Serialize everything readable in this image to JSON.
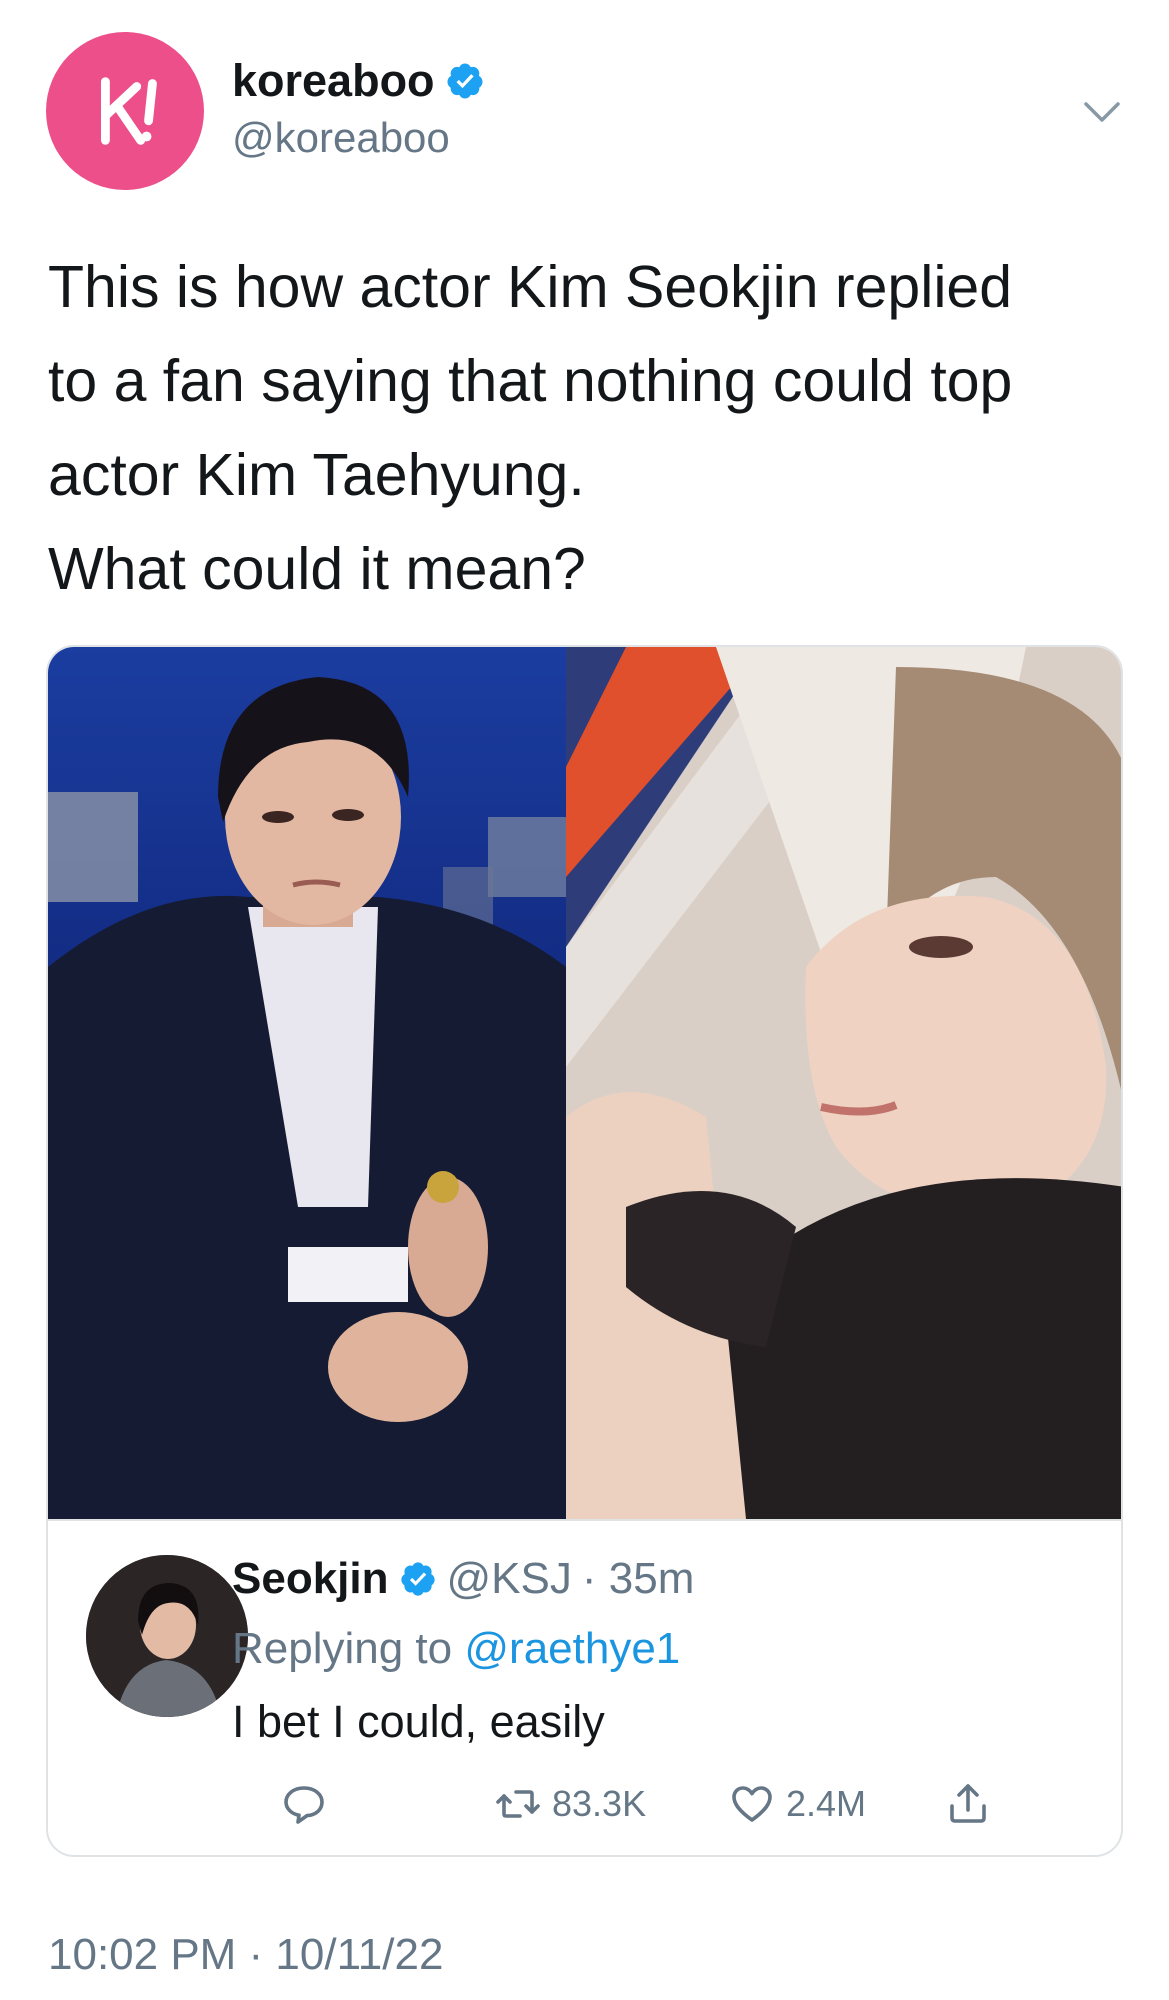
{
  "tweet": {
    "display_name": "koreaboo",
    "handle": "@koreaboo",
    "avatar_letter": "k!",
    "avatar_color": "#ec4f8a",
    "text_lines": [
      "This is how actor Kim Seokjin replied",
      "to a fan saying that nothing could top",
      "actor Kim Taehyung.",
      "What could it mean?"
    ],
    "timestamp": "10:02 PM · 10/11/22"
  },
  "quoted_reply": {
    "display_name": "Seokjin",
    "handle": "@KSJ",
    "time": "· 35m",
    "replying_label": "Replying to",
    "replying_to": "@raethye1",
    "text": "I bet I could, easily",
    "retweets": "83.3K",
    "likes": "2.4M"
  },
  "colors": {
    "text": "#14171a",
    "secondary": "#657786",
    "link": "#1b95e0",
    "verified": "#1da1f2",
    "border": "#dfe3e6"
  }
}
